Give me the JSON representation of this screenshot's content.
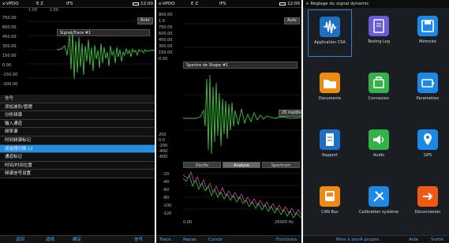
{
  "panel1": {
    "status": {
      "left": "x-VPDO",
      "mid": "E Z",
      "right": "IFS",
      "sub": "1.00",
      "sub2": "1.00",
      "time": "12:00"
    },
    "ticks": [
      "750.00",
      "600.00",
      "450.00",
      "300.00",
      "150.00",
      "0.00",
      "-150.00",
      "-300.00"
    ],
    "trace_title": "Signal Trace #1",
    "chip": "Auto",
    "menu": {
      "header": "信号",
      "items": [
        "添加波形/管理",
        "分析频谱",
        "输入通道",
        "频率谱",
        "时间频谱标记",
        "滤波器切换 L2",
        "通道标记",
        "时间/时间位置",
        "频谱信号设置"
      ],
      "selected_index": 5
    },
    "bottom": [
      "返回",
      "选择",
      "确定",
      "信号"
    ]
  },
  "panel2": {
    "status": {
      "left": "x-VPDO",
      "mid": "E Z",
      "right": "IFS",
      "time": "12:00"
    },
    "chip_top": "Auto",
    "top_ticks": [
      "800.00",
      "1.0",
      "750.00",
      "600.00",
      "450.00",
      "300.00",
      "150.00",
      "0.00"
    ],
    "trace_title": "Spectre de Shape #1",
    "bottom_ticks": [
      "200",
      "0.0",
      "-200",
      "-400",
      "-600"
    ],
    "chip_mid": "25 ms/div",
    "tabs": [
      "Oscillo",
      "Analyse",
      "Spectrum"
    ],
    "active_tab": 1,
    "spec_ticks": [
      "-20",
      "-40",
      "-60",
      "-80",
      "-100",
      "-120"
    ],
    "axis_left": "0.00",
    "axis_right": "25000 Hz",
    "bottom": [
      "Trace",
      "Repas",
      "Cursor",
      "Fonctions"
    ]
  },
  "panel3": {
    "header": "+ Réglage du signal dynamic",
    "apps": [
      {
        "label": "Application CSA",
        "icon": "waveform-icon",
        "color": "#1e6fc8"
      },
      {
        "label": "Testing Log",
        "icon": "clipboard-icon",
        "color": "#6a5bd6"
      },
      {
        "label": "Mémoire",
        "icon": "save-icon",
        "color": "#1e88e5"
      },
      {
        "label": "Documents",
        "icon": "folder-icon",
        "color": "#ef8a12"
      },
      {
        "label": "Connexion",
        "icon": "connect-icon",
        "color": "#33b249"
      },
      {
        "label": "Paramètres",
        "icon": "battery-icon",
        "color": "#1e88e5"
      },
      {
        "label": "Rapport",
        "icon": "document-icon",
        "color": "#1e6fc8"
      },
      {
        "label": "Audio",
        "icon": "speaker-icon",
        "color": "#33b249"
      },
      {
        "label": "GPS",
        "icon": "map-pin-icon",
        "color": "#1e88e5"
      },
      {
        "label": "CAN Bus",
        "icon": "bus-icon",
        "color": "#ef8a12"
      },
      {
        "label": "Calibration système",
        "icon": "tools-icon",
        "color": "#1e88e5"
      },
      {
        "label": "Déconnexion",
        "icon": "logout-icon",
        "color": "#ef5a12"
      }
    ],
    "bottom": [
      "Mise à jour",
      "À propos",
      "Aide",
      "Sortie"
    ]
  }
}
